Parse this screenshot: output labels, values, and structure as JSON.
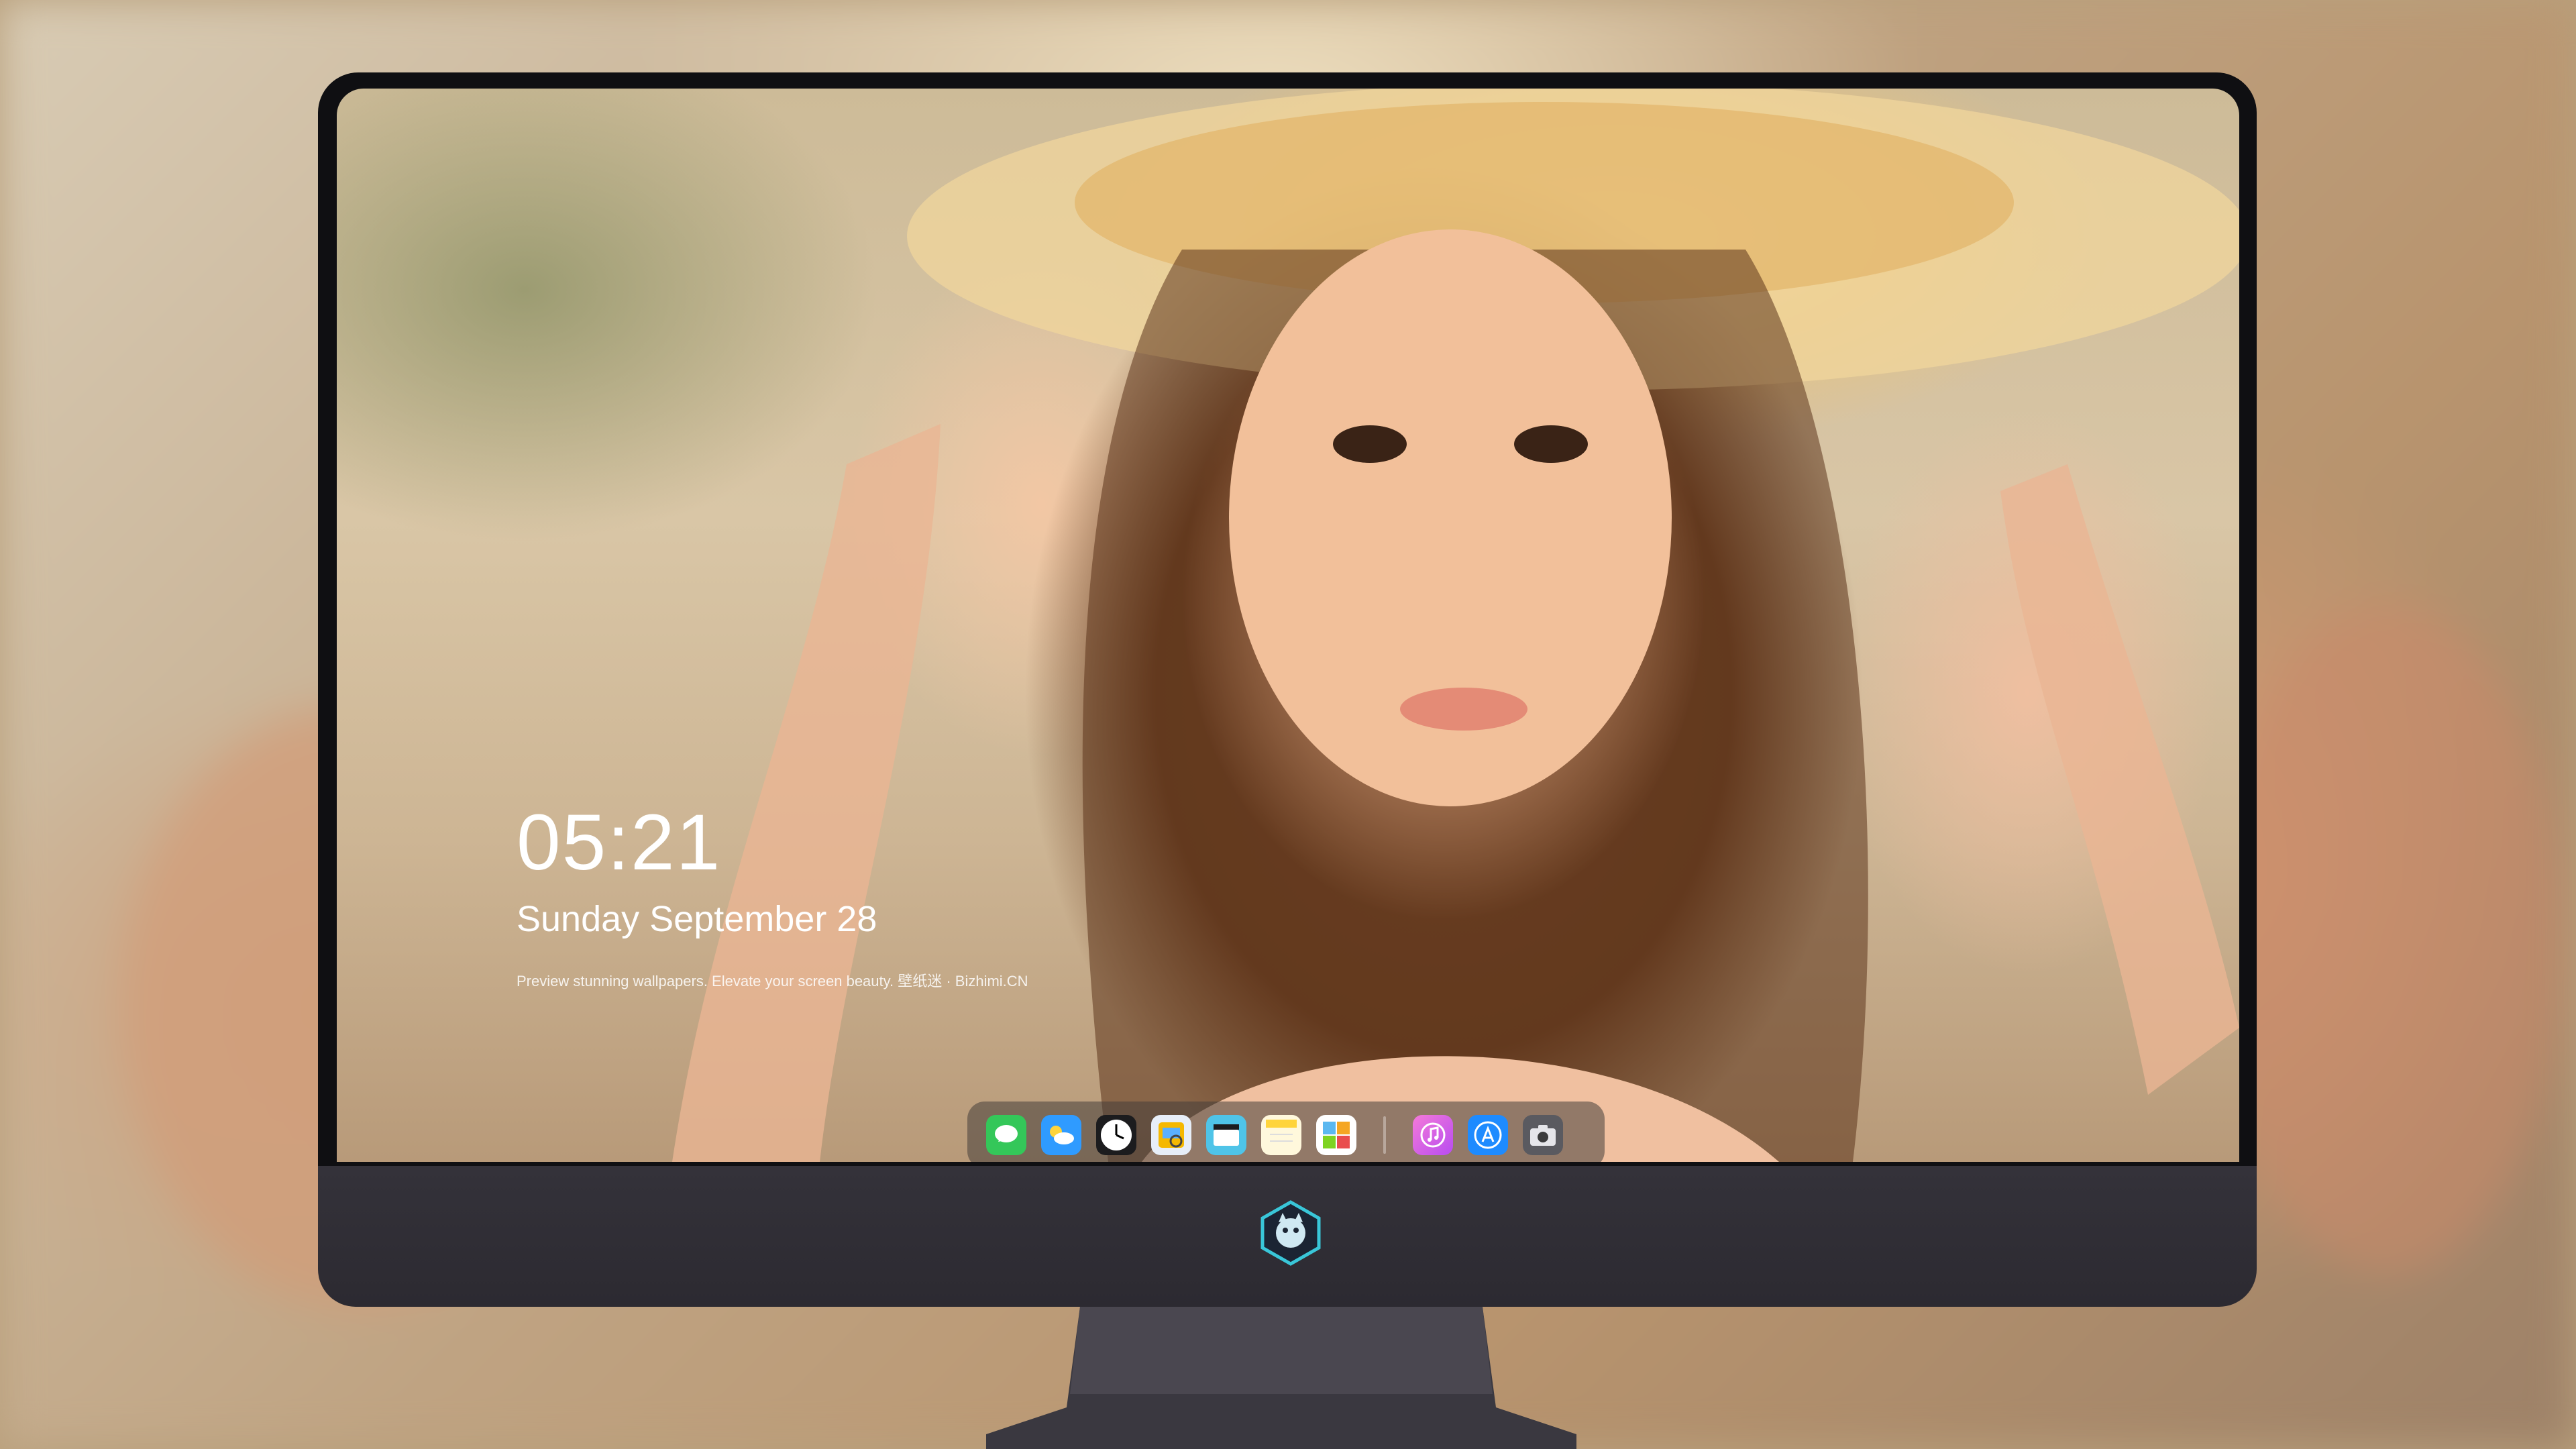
{
  "lock_screen": {
    "time": "05:21",
    "date": "Sunday September  28",
    "tagline": "Preview stunning wallpapers. Elevate your screen beauty. 壁纸迷 · Bizhimi.CN"
  },
  "dock": {
    "apps": [
      {
        "name": "messages-icon",
        "color": "#34c759"
      },
      {
        "name": "weather-icon",
        "color": "#2f9bff"
      },
      {
        "name": "clock-icon",
        "color": "#1c1c1e"
      },
      {
        "name": "preview-icon",
        "color": "#f5b800"
      },
      {
        "name": "clips-icon",
        "color": "#4fc4e8"
      },
      {
        "name": "notes-icon",
        "color": "#ffd43b"
      },
      {
        "name": "photo-booth-icon",
        "color": "#5bb8f0"
      },
      {
        "name": "music-icon",
        "color": "#e24ad9"
      },
      {
        "name": "app-store-icon",
        "color": "#1e8bff"
      },
      {
        "name": "screenshot-icon",
        "color": "#5a5a60"
      }
    ]
  },
  "brand_logo": "hexagon-mascot-logo"
}
